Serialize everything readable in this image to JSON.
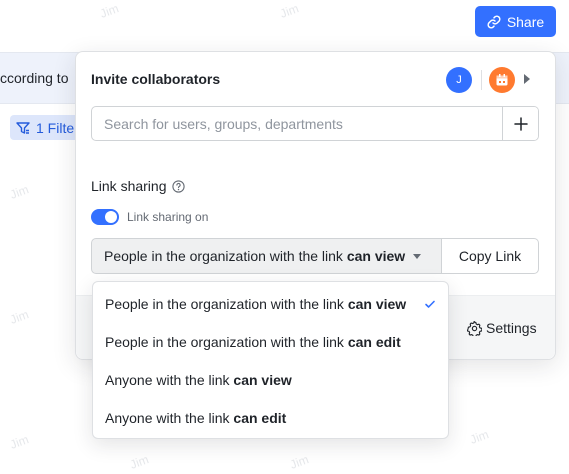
{
  "toolbar": {
    "share_label": "Share"
  },
  "background": {
    "row_text": "ccording to",
    "filter_label": "1 Filte",
    "watermark": "Jim"
  },
  "invite": {
    "title": "Invite collaborators",
    "avatar_initial": "J",
    "search_placeholder": "Search for users, groups, departments"
  },
  "link_sharing": {
    "label": "Link sharing",
    "toggle_text": "Link sharing on",
    "selected_prefix": "People in the organization with the link ",
    "selected_suffix": "can view",
    "copy_label": "Copy Link"
  },
  "footer": {
    "settings_label": "Settings"
  },
  "dropdown": {
    "options": [
      {
        "prefix": "People in the organization with the link ",
        "bold": "can view"
      },
      {
        "prefix": "People in the organization with the link ",
        "bold": "can edit"
      },
      {
        "prefix": "Anyone with the link ",
        "bold": "can view"
      },
      {
        "prefix": "Anyone with the link ",
        "bold": "can edit"
      }
    ],
    "selected_index": 0
  },
  "colors": {
    "accent": "#3370ff",
    "app_avatar": "#ff7a2f"
  }
}
